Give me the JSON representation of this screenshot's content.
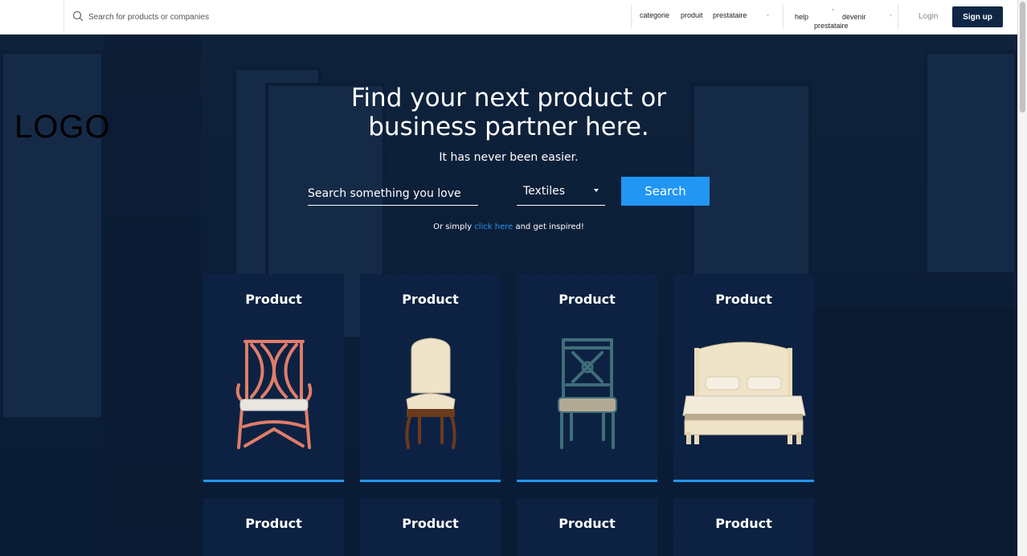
{
  "topbar": {
    "search_placeholder": "Search for products or companies",
    "nav": {
      "categorie": "categorie",
      "produit": "produit",
      "prestataire": "prestataire",
      "help": "help",
      "devenir": "devenir",
      "devenir_prestataire": "prestataire"
    },
    "login_label": "Login",
    "signup_label": "Sign up"
  },
  "logo_text": "LOGO",
  "hero": {
    "headline_line1": "Find your next product or",
    "headline_line2": "business partner here.",
    "subline": "It has never been easier.",
    "search_placeholder": "Search something you love",
    "category_value": "Textiles",
    "search_button": "Search",
    "inspire_prefix": "Or simply ",
    "inspire_link": "click here",
    "inspire_suffix": " and get inspired!"
  },
  "products": [
    {
      "title": "Product",
      "image": "coral-armchair"
    },
    {
      "title": "Product",
      "image": "upholstered-side-chair"
    },
    {
      "title": "Product",
      "image": "teal-dining-chair"
    },
    {
      "title": "Product",
      "image": "cream-bed"
    },
    {
      "title": "Product"
    },
    {
      "title": "Product"
    },
    {
      "title": "Product"
    },
    {
      "title": "Product"
    }
  ],
  "colors": {
    "accent": "#2196f3",
    "navy": "#0f2744",
    "card": "#0d2242"
  }
}
